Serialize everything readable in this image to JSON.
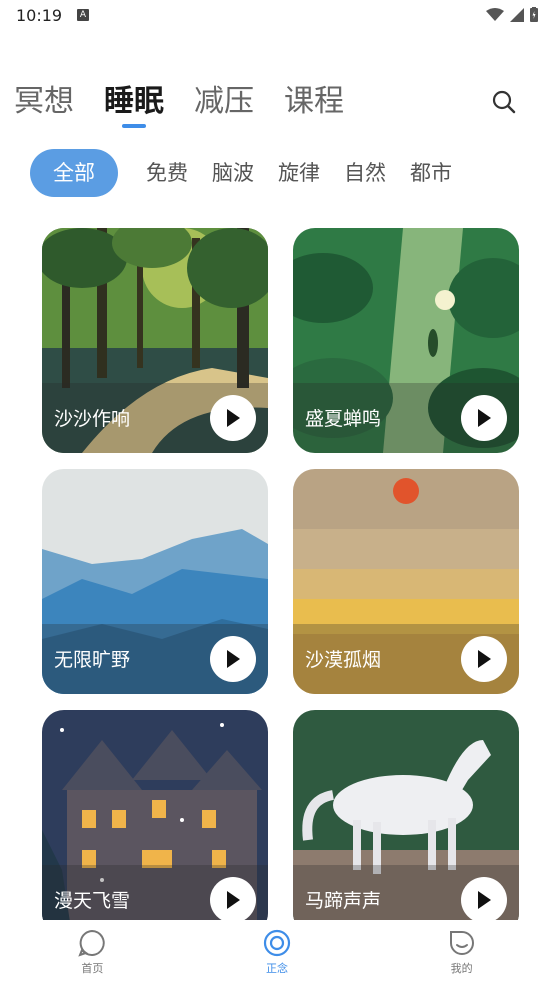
{
  "status_bar": {
    "time": "10:19",
    "badge": "A"
  },
  "top_tabs": [
    {
      "label": "冥想",
      "active": false
    },
    {
      "label": "睡眠",
      "active": true
    },
    {
      "label": "减压",
      "active": false
    },
    {
      "label": "课程",
      "active": false
    }
  ],
  "filters": [
    {
      "label": "全部",
      "active": true
    },
    {
      "label": "免费",
      "active": false
    },
    {
      "label": "脑波",
      "active": false
    },
    {
      "label": "旋律",
      "active": false
    },
    {
      "label": "自然",
      "active": false
    },
    {
      "label": "都市",
      "active": false
    }
  ],
  "cards": [
    {
      "title": "沙沙作响",
      "theme": "forest"
    },
    {
      "title": "盛夏蝉鸣",
      "theme": "leaves"
    },
    {
      "title": "无限旷野",
      "theme": "mountains"
    },
    {
      "title": "沙漠孤烟",
      "theme": "desert"
    },
    {
      "title": "漫天飞雪",
      "theme": "snow-house"
    },
    {
      "title": "马蹄声声",
      "theme": "horse"
    }
  ],
  "bottom_nav": [
    {
      "label": "首页",
      "icon": "home-bubble-icon",
      "active": false
    },
    {
      "label": "正念",
      "icon": "mindfulness-ring-icon",
      "active": true
    },
    {
      "label": "我的",
      "icon": "smile-profile-icon",
      "active": false
    }
  ],
  "colors": {
    "accent": "#3e8de8",
    "chip_active": "#5b9de3"
  }
}
